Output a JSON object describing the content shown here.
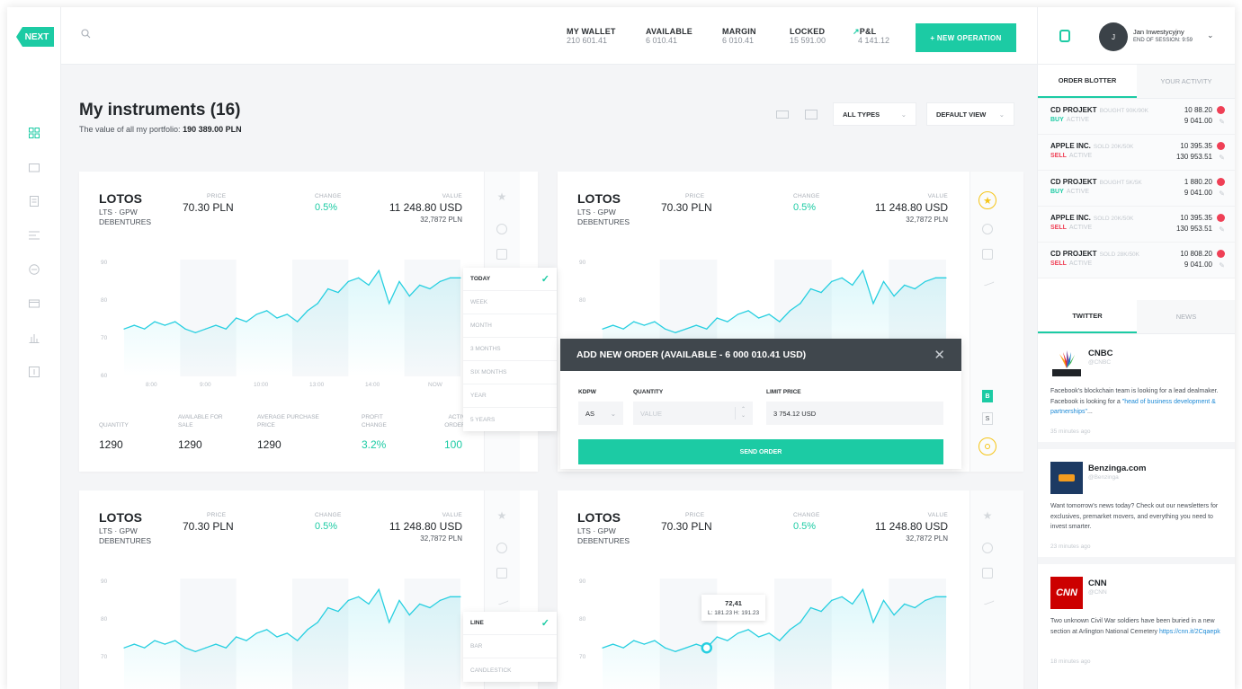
{
  "logo": "NEXT",
  "topbar": {
    "stats": [
      {
        "label": "MY WALLET",
        "value": "210 601.41"
      },
      {
        "label": "AVAILABLE",
        "value": "6 010.41"
      },
      {
        "label": "MARGIN",
        "value": "6 010.41"
      },
      {
        "label": "LOCKED",
        "value": "15 591.00"
      },
      {
        "label": "P&L",
        "value": "4 141.12"
      }
    ],
    "new_operation": "+ NEW OPERATION"
  },
  "user": {
    "initials": "J",
    "name": "Jan Inwestycyjny",
    "session": "END OF SESSION: 9:59"
  },
  "main": {
    "title": "My instruments (16)",
    "sub_label": "The value of all my portfolio:",
    "sub_value": "190 389.00 PLN",
    "filter_types": "ALL TYPES",
    "filter_view": "DEFAULT VIEW"
  },
  "card": {
    "name": "LOTOS",
    "ticker": "LTS · GPW",
    "type": "DEBENTURES",
    "price_label": "PRICE",
    "price": "70.30 PLN",
    "change_label": "CHANGE",
    "change": "0.5%",
    "value_label": "VALUE",
    "value": "11 248.80 USD",
    "value_sub": "32,7872 PLN",
    "y_ticks": [
      "90",
      "80",
      "70",
      "60"
    ],
    "x_ticks": [
      "8:00",
      "9:00",
      "10:00",
      "13:00",
      "14:00",
      "NOW"
    ],
    "footer": [
      {
        "label": "QUANTITY",
        "value": "1290"
      },
      {
        "label": "AVAILABLE FOR SALE",
        "value": "1290"
      },
      {
        "label": "AVERAGE PURCHASE PRICE",
        "value": "1290"
      },
      {
        "label": "PROFIT CHANGE",
        "value": "3.2%"
      },
      {
        "label": "ACTIVE ORDERS",
        "value": "100"
      }
    ]
  },
  "chart_data": {
    "type": "line",
    "x": [
      "8:00",
      "9:00",
      "10:00",
      "13:00",
      "14:00",
      "NOW"
    ],
    "y": [
      73,
      74,
      73,
      75,
      74,
      75,
      73,
      72,
      73,
      74,
      73,
      76,
      75,
      77,
      78,
      76,
      77,
      75,
      78,
      80,
      84,
      83,
      86,
      87,
      85,
      89,
      80,
      86,
      82,
      85,
      84,
      86,
      87,
      87
    ],
    "ylim": [
      60,
      92
    ],
    "y_ticks": [
      90,
      80,
      70,
      60
    ],
    "grid": false
  },
  "period_dropdown": [
    {
      "label": "TODAY",
      "active": true
    },
    {
      "label": "WEEK",
      "active": false
    },
    {
      "label": "MONTH",
      "active": false
    },
    {
      "label": "3 MONTHS",
      "active": false
    },
    {
      "label": "SIX MONTHS",
      "active": false
    },
    {
      "label": "YEAR",
      "active": false
    },
    {
      "label": "5 YEARS",
      "active": false
    }
  ],
  "chart_type_dropdown": [
    {
      "label": "LINE",
      "active": true
    },
    {
      "label": "BAR",
      "active": false
    },
    {
      "label": "CANDLESTICK",
      "active": false
    }
  ],
  "order": {
    "title": "ADD NEW ORDER (AVAILABLE - 6 000 010.41 USD)",
    "kdpw_label": "KDPW",
    "kdpw_value": "AS",
    "quantity_label": "QUANTITY",
    "quantity_placeholder": "VALUE",
    "limit_label": "LIMIT PRICE",
    "limit_value": "3 754.12 USD",
    "send": "SEND ORDER"
  },
  "tooltip": {
    "value": "72,41",
    "low": "L: 181.23",
    "high": "H: 191.23"
  },
  "right": {
    "tabs1": [
      "ORDER BLOTTER",
      "YOUR ACTIVITY"
    ],
    "orders": [
      {
        "name": "CD PROJEKT",
        "meta": "BOUGHT 90K/90K",
        "side": "BUY",
        "status": "ACTIVE",
        "v1": "10 88.20",
        "v2": "9 041.00"
      },
      {
        "name": "APPLE INC.",
        "meta": "SOLD 20K/50K",
        "side": "SELL",
        "status": "ACTIVE",
        "v1": "10 395.35",
        "v2": "130 953.51"
      },
      {
        "name": "CD PROJEKT",
        "meta": "BOUGHT 5K/5K",
        "side": "BUY",
        "status": "ACTIVE",
        "v1": "1 880.20",
        "v2": "9 041.00"
      },
      {
        "name": "APPLE INC.",
        "meta": "SOLD 20K/50K",
        "side": "SELL",
        "status": "ACTIVE",
        "v1": "10 395.35",
        "v2": "130 953.51"
      },
      {
        "name": "CD PROJEKT",
        "meta": "SOLD 28K/50K",
        "side": "SELL",
        "status": "ACTIVE",
        "v1": "10 808.20",
        "v2": "9 041.00"
      }
    ],
    "tabs2": [
      "TWITTER",
      "NEWS"
    ],
    "tweets": [
      {
        "name": "CNBC",
        "handle": "@CNBC",
        "text": "Facebook's blockchain team is looking for a lead dealmaker. Facebook is looking for a ",
        "link": "\"head of business development & partnerships\"",
        "text_after": "...",
        "time": "35 minutes ago"
      },
      {
        "name": "Benzinga.com",
        "handle": "@Benzinga",
        "text": "Want tomorrow's news today? Check out our newsletters for exclusives, premarket movers, and everything you need to invest smarter.",
        "link": "",
        "text_after": "",
        "time": "23 minutes ago"
      },
      {
        "name": "CNN",
        "handle": "@CNN",
        "text": "Two unknown Civil War soldiers have been buried in a new section at Arlington National Cemetery ",
        "link": "https://cnn.it/2Cqaepk",
        "text_after": "",
        "time": "18 minutes ago"
      }
    ]
  }
}
